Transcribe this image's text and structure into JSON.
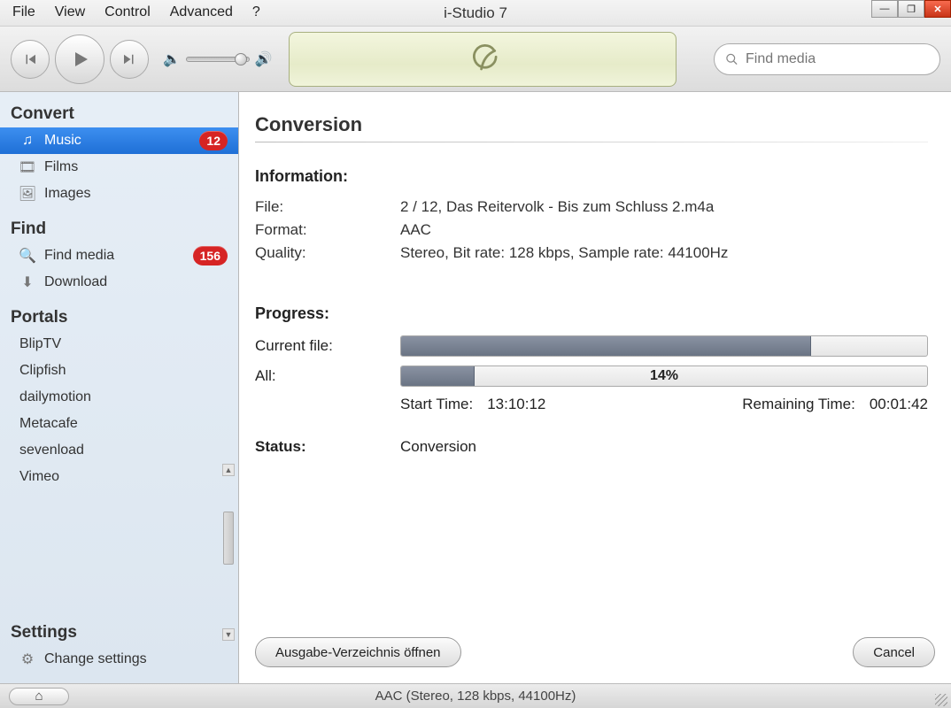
{
  "window": {
    "title": "i-Studio 7",
    "menus": [
      "File",
      "View",
      "Control",
      "Advanced",
      "?"
    ]
  },
  "toolbar": {
    "search_placeholder": "Find media"
  },
  "sidebar": {
    "sections": {
      "convert": {
        "title": "Convert",
        "items": [
          {
            "label": "Music",
            "badge": "12"
          },
          {
            "label": "Films"
          },
          {
            "label": "Images"
          }
        ]
      },
      "find": {
        "title": "Find",
        "items": [
          {
            "label": "Find media",
            "badge": "156"
          },
          {
            "label": "Download"
          }
        ]
      },
      "portals": {
        "title": "Portals",
        "items": [
          {
            "label": "BlipTV"
          },
          {
            "label": "Clipfish"
          },
          {
            "label": "dailymotion"
          },
          {
            "label": "Metacafe"
          },
          {
            "label": "sevenload"
          },
          {
            "label": "Vimeo"
          }
        ]
      },
      "settings": {
        "title": "Settings",
        "items": [
          {
            "label": "Change settings"
          }
        ]
      }
    }
  },
  "content": {
    "heading": "Conversion",
    "info_header": "Information:",
    "info": {
      "file_label": "File:",
      "file_value": "2 / 12, Das Reitervolk - Bis zum Schluss 2.m4a",
      "format_label": "Format:",
      "format_value": "AAC",
      "quality_label": "Quality:",
      "quality_value": "Stereo, Bit rate: 128 kbps, Sample rate: 44100Hz"
    },
    "progress_header": "Progress:",
    "progress": {
      "current_label": "Current file:",
      "current_pct": 78,
      "all_label": "All:",
      "all_pct_label": "14%",
      "all_pct": 14,
      "start_label": "Start Time:",
      "start_value": "13:10:12",
      "remain_label": "Remaining Time:",
      "remain_value": "00:01:42"
    },
    "status_label": "Status:",
    "status_value": "Conversion",
    "open_dir_btn": "Ausgabe-Verzeichnis öffnen",
    "cancel_btn": "Cancel"
  },
  "statusbar": {
    "text": "AAC (Stereo, 128 kbps, 44100Hz)"
  }
}
